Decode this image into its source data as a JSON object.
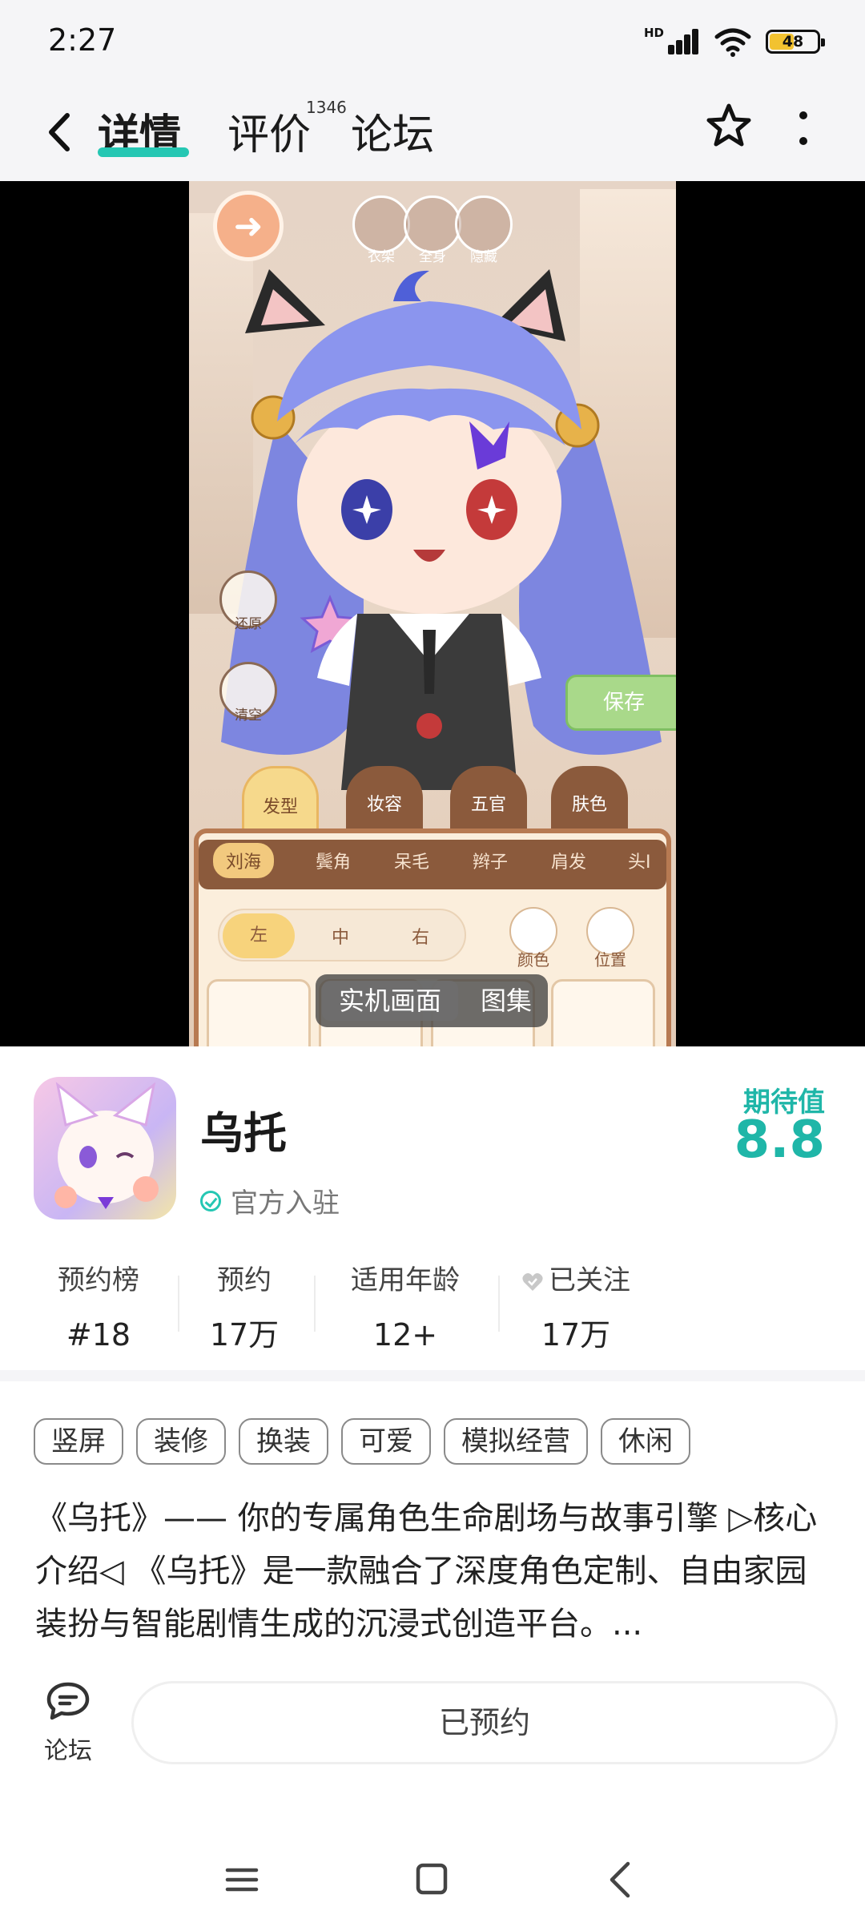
{
  "status_bar": {
    "time": "2:27",
    "network": "HD",
    "battery": "48"
  },
  "nav": {
    "tabs": [
      {
        "label": "详情",
        "active": true
      },
      {
        "label": "评价",
        "active": false
      },
      {
        "label": "论坛",
        "active": false
      }
    ],
    "review_count": "1346",
    "icons": [
      "back-arrow-icon",
      "star-icon",
      "more-vertical-icon"
    ]
  },
  "media": {
    "toggle": {
      "options": [
        "实机画面",
        "图集"
      ],
      "selected": "实机画面"
    },
    "game_ui": {
      "top_tools": [
        "衣架",
        "全身",
        "隐藏"
      ],
      "side_tools": [
        "还原",
        "清空"
      ],
      "save_label": "保存",
      "categories": [
        "发型",
        "妆容",
        "五官",
        "肤色"
      ],
      "subtabs": [
        "刘海",
        "鬓角",
        "呆毛",
        "辫子",
        "肩发",
        "头I"
      ],
      "positions": [
        "左",
        "中",
        "右"
      ],
      "mini_tools": [
        "颜色",
        "位置"
      ]
    }
  },
  "app": {
    "name": "乌托",
    "official_label": "官方入驻",
    "expect_label": "期待值",
    "expect_value": "8.8"
  },
  "stats": [
    {
      "label": "预约榜",
      "value": "#18"
    },
    {
      "label": "预约",
      "value": "17万"
    },
    {
      "label": "适用年龄",
      "value": "12+"
    },
    {
      "label": "已关注",
      "value": "17万"
    }
  ],
  "tags": [
    "竖屏",
    "装修",
    "换装",
    "可爱",
    "模拟经营",
    "休闲"
  ],
  "description": "《乌托》—— 你的专属角色生命剧场与故事引擎 ▷核心介绍◁ 《乌托》是一款融合了深度角色定制、自由家园装扮与智能剧情生成的沉浸式创造平台。...",
  "bottom_bar": {
    "forum_label": "论坛",
    "reserve_label": "已预约"
  },
  "colors": {
    "accent": "#25c7b3",
    "expect": "#1fb6a8",
    "page_bg": "#f5f5f7"
  }
}
